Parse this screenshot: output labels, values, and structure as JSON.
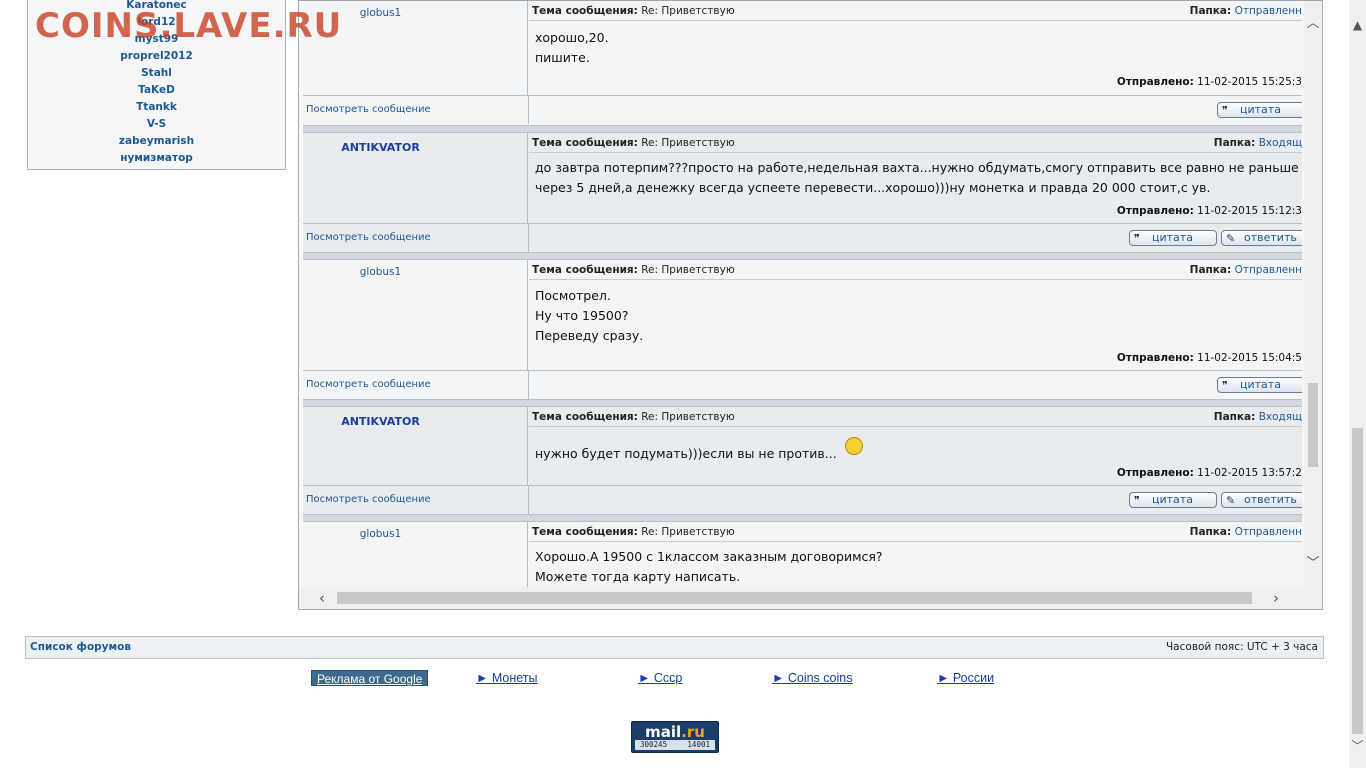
{
  "watermark": "COINS.LAVE.RU",
  "online_users": [
    "Karatonec",
    "lord12",
    "myst99",
    "proprel2012",
    "Stahl",
    "TaKeD",
    "Ttankk",
    "V-S",
    "zabeymarish",
    "нумизматор"
  ],
  "labels": {
    "subject": "Тема сообщения:",
    "folder": "Папка:",
    "sent": "Отправлено:",
    "view_message": "Посмотреть сообщение",
    "quote": "цитата",
    "reply": "ответить"
  },
  "messages": [
    {
      "author": "globus1",
      "subject": "Re: Приветствую",
      "folder": "Отправленн",
      "lines": [
        "хорошо,20.",
        "пишите."
      ],
      "sent": "11-02-2015 15:25:3"
    },
    {
      "author": "ANTIKVATOR",
      "subject": "Re: Приветствую",
      "folder": "Входящ",
      "lines": [
        "до завтра потерпим???просто на работе,недельная вахта...нужно обдумать,смогу отправить все равно не раньше чем",
        "через 5 дней,а денежку всегда успеете перевести...хорошо)))ну монетка и правда 20 000 стоит,с ув."
      ],
      "sent": "11-02-2015 15:12:3"
    },
    {
      "author": "globus1",
      "subject": "Re: Приветствую",
      "folder": "Отправленн",
      "lines": [
        "Посмотрел.",
        "Ну что 19500?",
        "Переведу сразу."
      ],
      "sent": "11-02-2015 15:04:5"
    },
    {
      "author": "ANTIKVATOR",
      "subject": "Re: Приветствую",
      "folder": "Входящ",
      "lines": [
        "нужно будет подумать)))если вы не против..."
      ],
      "sent": "11-02-2015 13:57:2"
    },
    {
      "author": "globus1",
      "subject": "Re: Приветствую",
      "folder": "Отправленн",
      "lines": [
        "Хорошо.А 19500 с 1классом заказным договоримся?",
        "Можете тогда карту написать."
      ],
      "sent": ""
    }
  ],
  "footer": {
    "forums_link": "Список форумов",
    "timezone": "Часовой пояс: UTC + 3 часа"
  },
  "ads": {
    "google": "Реклама от Google",
    "links": [
      "► Монеты",
      "► Ссср",
      "► Coins coins",
      "► России"
    ]
  },
  "counter": {
    "brand_main": "mail",
    "brand_tld": ".ru",
    "num1": "300245",
    "num2": "14001"
  }
}
